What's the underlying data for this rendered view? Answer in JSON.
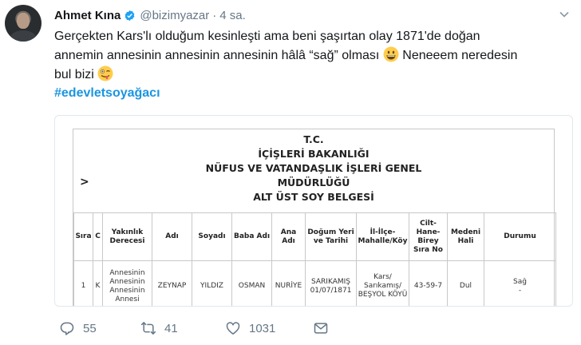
{
  "tweet": {
    "author_name": "Ahmet Kına",
    "handle": "@bizimyazar",
    "separator": "·",
    "time": "4 sa.",
    "text_line1": "Gerçekten Kars'lı olduğum kesinleşti ama beni şaşırtan olay 1871'de doğan",
    "text_line2_a": "annemin annesinin annesinin annesinin hâlâ “sağ” olması",
    "text_line2_b": "Neneeem neredesin",
    "text_line3": "bul bizi",
    "hashtag": "#edevletsoyağacı",
    "verified_icon": "verified-badge-icon",
    "accent_color": "#1b95e0"
  },
  "document": {
    "title_lines": [
      "T.C.",
      "İÇİŞLERİ BAKANLIĞI",
      "NÜFUS VE VATANDAŞLIK İŞLERİ GENEL",
      "MÜDÜRLÜĞÜ",
      "ALT ÜST SOY BELGESİ"
    ],
    "arrow": ">",
    "columns": [
      "Sıra",
      "C",
      "Yakınlık Derecesi",
      "Adı",
      "Soyadı",
      "Baba Adı",
      "Ana Adı",
      "Doğum Yeri ve Tarihi",
      "İl-İlçe-Mahalle/Köy",
      "Cilt-Hane-Birey Sıra No",
      "Medeni Hali",
      "Durumu"
    ],
    "row": {
      "sira": "1",
      "c": "K",
      "yakinlik": "Annesinin Annesinin Annesinin Annesi",
      "adi": "ZEYNAP",
      "soyadi": "YILDIZ",
      "baba_adi": "OSMAN",
      "ana_adi": "NURİYE",
      "dogum": "SARIKAMIŞ 01/07/1871",
      "il_ilce": "Kars/ Sarıkamış/ BEŞYOL KÖYÜ",
      "cilt": "43-59-7",
      "medeni": "Dul",
      "durumu": "Sağ",
      "durumu_extra": "-"
    }
  },
  "actions": {
    "reply_count": "55",
    "retweet_count": "41",
    "like_count": "1031"
  }
}
